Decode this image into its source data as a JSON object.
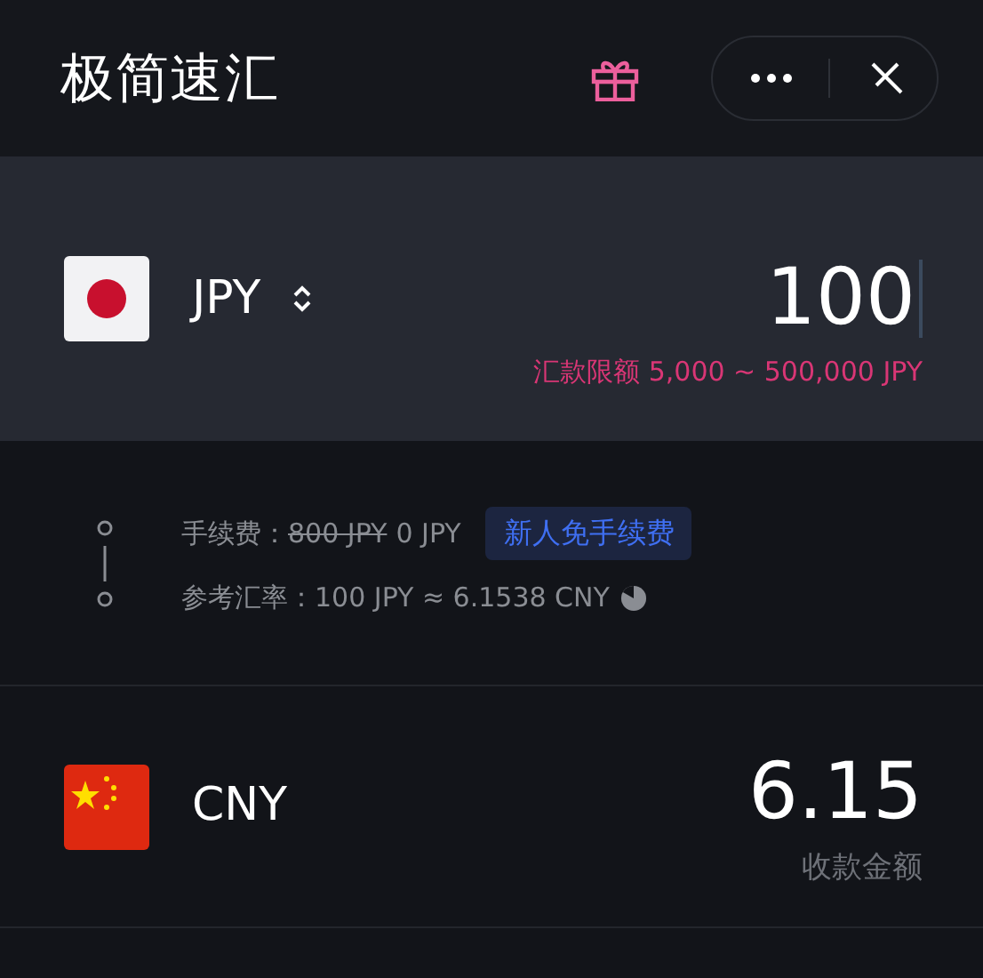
{
  "header": {
    "title": "极简速汇"
  },
  "source": {
    "currency": "JPY",
    "kind": "jp",
    "amount": "100",
    "limit": "汇款限额 5,000 ~ 500,000 JPY"
  },
  "fee": {
    "label": "手续费：",
    "original": "800 JPY",
    "current": "0 JPY",
    "badge": "新人免手续费"
  },
  "rate": {
    "label": "参考汇率：",
    "value": "100 JPY ≈ 6.1538 CNY"
  },
  "target": {
    "currency": "CNY",
    "kind": "cn",
    "amount": "6.15",
    "caption": "收款金额"
  }
}
